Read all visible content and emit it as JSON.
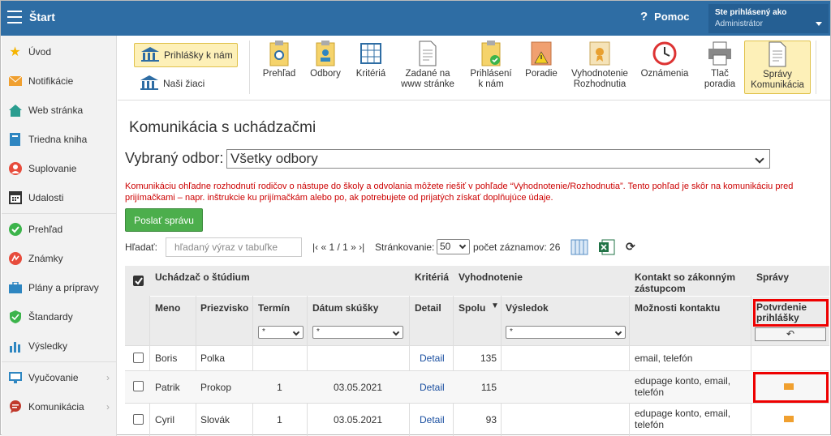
{
  "app": {
    "title": "Štart",
    "help": "Pomoc",
    "user_line1": "Ste prihlásený ako",
    "user_line2": "Administrátor"
  },
  "sidebar": {
    "items": [
      {
        "label": "Úvod",
        "icon": "star-icon"
      },
      {
        "label": "Notifikácie",
        "icon": "envelope-icon"
      },
      {
        "label": "Web stránka",
        "icon": "home-icon"
      },
      {
        "label": "Triedna kniha",
        "icon": "book-icon"
      },
      {
        "label": "Suplovanie",
        "icon": "person-icon"
      },
      {
        "label": "Udalosti",
        "icon": "calendar-icon"
      },
      {
        "label": "Prehľad",
        "icon": "check-circle-icon"
      },
      {
        "label": "Známky",
        "icon": "grades-icon"
      },
      {
        "label": "Plány a prípravy",
        "icon": "briefcase-icon"
      },
      {
        "label": "Štandardy",
        "icon": "shield-icon"
      },
      {
        "label": "Výsledky",
        "icon": "bar-chart-icon"
      },
      {
        "label": "Vyučovanie",
        "icon": "teaching-icon"
      },
      {
        "label": "Komunikácia",
        "icon": "chat-icon"
      }
    ]
  },
  "toolbar": {
    "left_buttons": [
      "Prihlášky k nám",
      "Naši žiaci"
    ],
    "tools": [
      {
        "label": "Prehľad",
        "label2": ""
      },
      {
        "label": "Odbory",
        "label2": ""
      },
      {
        "label": "Kritériá",
        "label2": ""
      },
      {
        "label": "Zadané na",
        "label2": "www stránke"
      },
      {
        "label": "Prihlásení",
        "label2": "k nám"
      },
      {
        "label": "Poradie",
        "label2": ""
      },
      {
        "label": "Vyhodnotenie",
        "label2": "Rozhodnutia"
      },
      {
        "label": "Oznámenia",
        "label2": ""
      },
      {
        "label": "Tlač",
        "label2": "poradia"
      },
      {
        "label": "Správy",
        "label2": "Komunikácia"
      }
    ]
  },
  "page": {
    "title": "Komunikácia s uchádzačmi",
    "odbor_label": "Vybraný odbor:",
    "odbor_value": "Všetky odbory",
    "warning": "Komunikáciu ohľadne rozhodnutí rodičov o nástupe do školy a odvolania môžete riešiť v pohľade “Vyhodnotenie/Rozhodnutia”. Tento pohľad je skôr na komunikáciu pred prijímačkami – napr. inštrukcie ku prijímačkám alebo po, ak potrebujete od prijatých získať doplňujúce údaje.",
    "send_button": "Poslať správu",
    "search_label": "Hľadať:",
    "search_placeholder": "hľadaný výraz v tabuľke",
    "pager": "|‹ « 1 / 1 » ›|",
    "paging_label": "Stránkovanie:",
    "paging_value": "50",
    "count_label": "počet záznamov: 26"
  },
  "table": {
    "groups": {
      "uchadzac": "Uchádzač o štúdium",
      "kriteria": "Kritériá",
      "vyhodnotenie": "Vyhodnotenie",
      "kontakt": "Kontakt so zákonným zástupcom",
      "spravy": "Správy"
    },
    "columns": {
      "meno": "Meno",
      "priezvisko": "Priezvisko",
      "termin": "Termín",
      "datum": "Dátum skúšky",
      "detail": "Detail",
      "spolu": "Spolu",
      "vysledok": "Výsledok",
      "moznosti": "Možnosti kontaktu",
      "potvrdenie": "Potvrdenie prihlášky"
    },
    "filters": {
      "termin": "*",
      "datum": "*",
      "vysledok": "*"
    },
    "rows": [
      {
        "meno": "Boris",
        "priezvisko": "Polka",
        "termin": "",
        "datum": "",
        "detail": "Detail",
        "spolu": "135",
        "vysledok": "",
        "kontakt": "email, telefón",
        "mail": false
      },
      {
        "meno": "Patrik",
        "priezvisko": "Prokop",
        "termin": "1",
        "datum": "03.05.2021",
        "detail": "Detail",
        "spolu": "115",
        "vysledok": "",
        "kontakt": "edupage konto, email, telefón",
        "mail": true
      },
      {
        "meno": "Cyril",
        "priezvisko": "Slovák",
        "termin": "1",
        "datum": "03.05.2021",
        "detail": "Detail",
        "spolu": "93",
        "vysledok": "",
        "kontakt": "edupage konto, email, telefón",
        "mail": true
      }
    ]
  },
  "colors": {
    "topbar": "#2e6da4",
    "accent_yellow": "#fdf0b8",
    "send_green": "#4cae4c",
    "warning_red": "#cc0000",
    "highlight_red": "#e00000"
  }
}
